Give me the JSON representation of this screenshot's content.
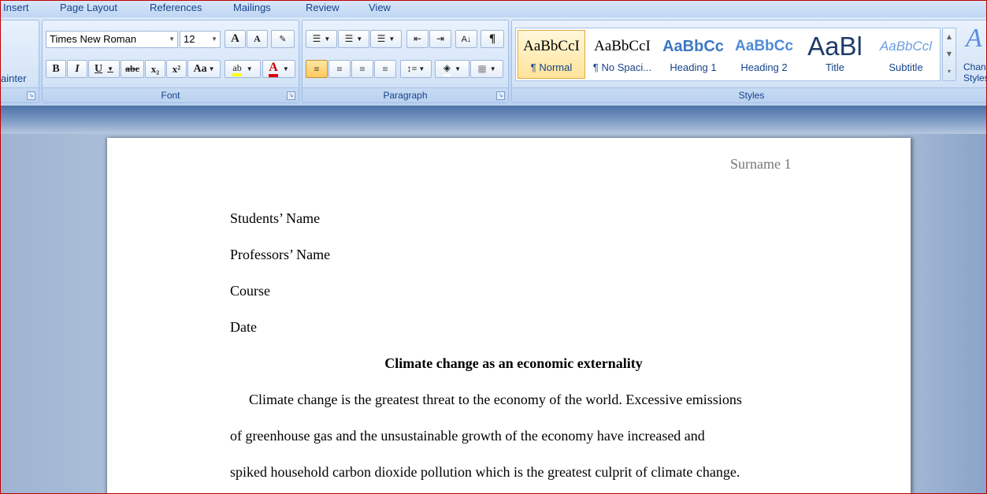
{
  "tabs": [
    "Insert",
    "Page Layout",
    "References",
    "Mailings",
    "Review",
    "View"
  ],
  "clipboard": {
    "painter_label": "ainter"
  },
  "font": {
    "name": "Times New Roman",
    "size": "12",
    "label": "Font",
    "bold": "B",
    "italic": "I",
    "underline": "U",
    "strike": "abc",
    "subscript": "x₂",
    "superscript": "x²",
    "change_case": "Aa",
    "grow": "A",
    "shrink": "A",
    "highlight": "ab",
    "color": "A"
  },
  "paragraph": {
    "label": "Paragraph",
    "sort": "A↓",
    "pilcrow": "¶"
  },
  "styles": {
    "label": "Styles",
    "items": [
      {
        "preview": "AaBbCcI",
        "name": "¶ Normal"
      },
      {
        "preview": "AaBbCcI",
        "name": "¶ No Spaci..."
      },
      {
        "preview": "AaBbCc",
        "name": "Heading 1"
      },
      {
        "preview": "AaBbCc",
        "name": "Heading 2"
      },
      {
        "preview": "AaBl",
        "name": "Title"
      },
      {
        "preview": "AaBbCcl",
        "name": "Subtitle"
      }
    ],
    "change_styles": "Change Styles"
  },
  "document": {
    "header": "Surname 1",
    "lines": [
      "Students’ Name",
      "Professors’ Name",
      "Course",
      "Date"
    ],
    "title": "Climate change as an economic externality",
    "body": [
      "Climate change is the greatest threat to the economy of the world. Excessive emissions",
      "of greenhouse gas and the unsustainable growth of the economy have increased and",
      "spiked household carbon dioxide pollution which is the greatest culprit of climate change."
    ]
  }
}
